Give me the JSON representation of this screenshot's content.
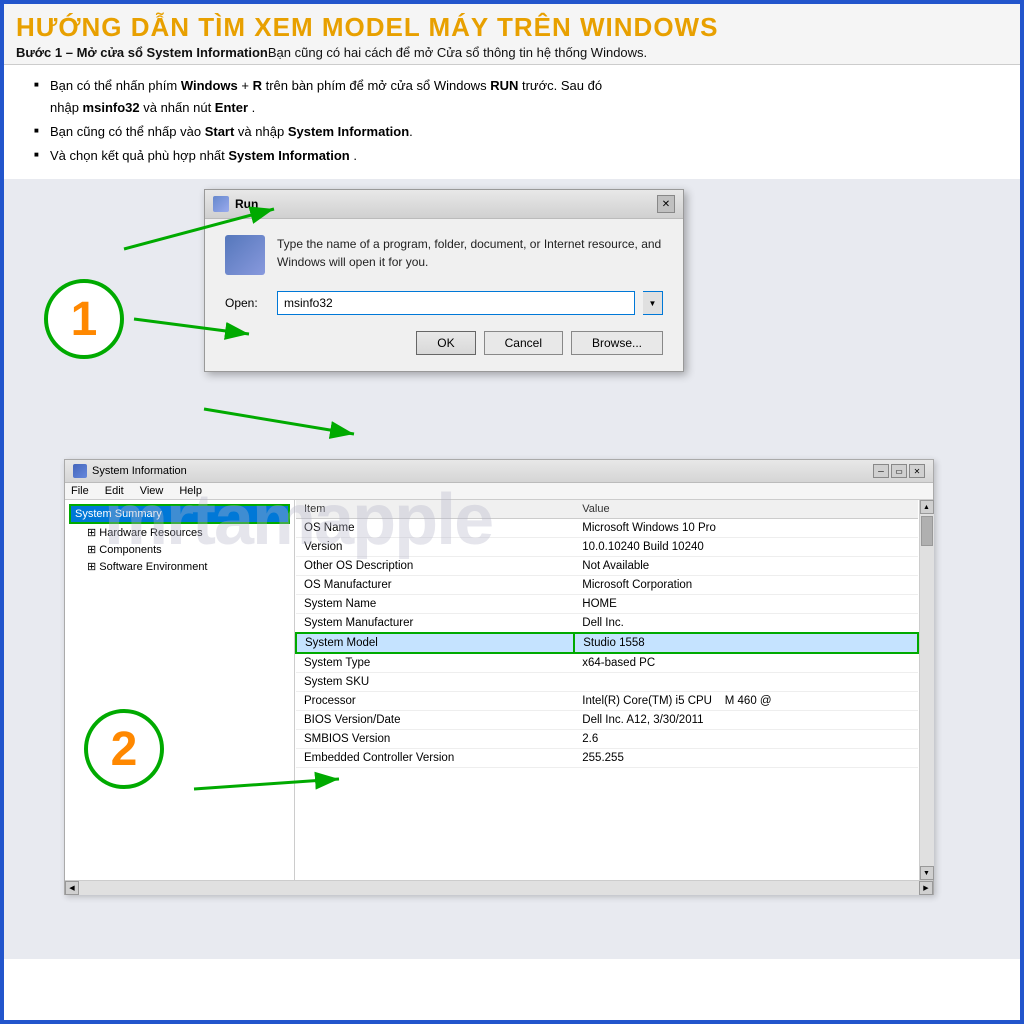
{
  "header": {
    "title": "HƯỚNG DẪN TÌM XEM MODEL MÁY TRÊN WINDOWS",
    "subtitle_bold": "Bước 1 – Mở cửa sổ System Information",
    "subtitle_normal": "Bạn cũng có hai cách để mở Cửa sổ thông tin hệ thống Windows."
  },
  "instructions": {
    "items": [
      {
        "parts": [
          {
            "text": "Bạn có thể nhấn phím "
          },
          {
            "text": "Windows",
            "bold": true
          },
          {
            "text": " + "
          },
          {
            "text": "R",
            "bold": true
          },
          {
            "text": " trên bàn phím để mở cửa sổ Windows "
          },
          {
            "text": "RUN",
            "bold": true
          },
          {
            "text": " trước. Sau đó nhập "
          },
          {
            "text": "msinfo32",
            "bold": true
          },
          {
            "text": " và nhấn nút "
          },
          {
            "text": "Enter",
            "bold": true
          },
          {
            "text": " ."
          }
        ]
      },
      {
        "parts": [
          {
            "text": "Bạn cũng có thể nhấp vào "
          },
          {
            "text": "Start",
            "bold": true
          },
          {
            "text": " và nhập "
          },
          {
            "text": "System Information",
            "bold": true
          },
          {
            "text": "."
          }
        ]
      },
      {
        "parts": [
          {
            "text": "Và chọn kết quả phù hợp nhất "
          },
          {
            "text": "System Information",
            "bold": true
          },
          {
            "text": " ."
          }
        ]
      }
    ]
  },
  "run_dialog": {
    "title": "Run",
    "description": "Type the name of a program, folder, document, or Internet resource, and Windows will open it for you.",
    "open_label": "Open:",
    "open_value": "msinfo32",
    "buttons": [
      "OK",
      "Cancel",
      "Browse..."
    ]
  },
  "sysinfo": {
    "title": "System Information",
    "menu_items": [
      "File",
      "Edit",
      "View",
      "Help"
    ],
    "tree": {
      "selected": "System Summary",
      "children": [
        "Hardware Resources",
        "Components",
        "Software Environment"
      ]
    },
    "table": {
      "headers": [
        "Item",
        "Value"
      ],
      "rows": [
        {
          "item": "OS Name",
          "value": "Microsoft Windows 10 Pro"
        },
        {
          "item": "Version",
          "value": "10.0.10240 Build 10240"
        },
        {
          "item": "Other OS Description",
          "value": "Not Available"
        },
        {
          "item": "OS Manufacturer",
          "value": "Microsoft Corporation"
        },
        {
          "item": "System Name",
          "value": "HOME"
        },
        {
          "item": "System Manufacturer",
          "value": "Dell Inc."
        },
        {
          "item": "System Model",
          "value": "Studio 1558",
          "highlighted": true
        },
        {
          "item": "System Type",
          "value": "x64-based PC"
        },
        {
          "item": "System SKU",
          "value": ""
        },
        {
          "item": "Processor",
          "value": "Intel(R) Core(TM) i5 CPU    M 460  @"
        },
        {
          "item": "BIOS Version/Date",
          "value": "Dell Inc. A12, 3/30/2011"
        },
        {
          "item": "SMBIOS Version",
          "value": "2.6"
        },
        {
          "item": "Embedded Controller Version",
          "value": "255.255"
        }
      ]
    }
  },
  "circles": {
    "c1_label": "1",
    "c2_label": "2"
  },
  "watermark": {
    "text": "mrtamapple"
  },
  "colors": {
    "title_yellow": "#e8a000",
    "circle_border": "#00aa00",
    "circle_text": "#ff8800",
    "highlight_border": "#00aa00",
    "border_blue": "#2255cc"
  }
}
